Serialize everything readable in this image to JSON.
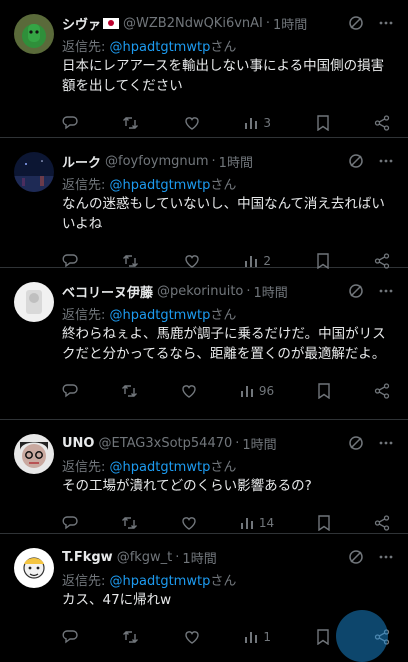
{
  "reply_prefix": "返信先:",
  "san_suffix": "さん",
  "tweets": [
    {
      "name": "シヴァ",
      "handle": "@WZB2NdwQKi6vnAI",
      "separator": "·",
      "time": "1時間",
      "reply_to": "@hpadtgtmwtp",
      "text": "日本にレアアースを輸出しない事による中国側の損害額を出してください",
      "views": "3"
    },
    {
      "name": "ルーク",
      "handle": "@foyfoymgnum",
      "separator": "·",
      "time": "1時間",
      "reply_to": "@hpadtgtmwtp",
      "text": "なんの迷惑もしていないし、中国なんて消え去ればいいよね",
      "views": "2"
    },
    {
      "name": "ベコリーヌ伊藤",
      "handle": "@pekorinuito",
      "separator": "·",
      "time": "1時間",
      "reply_to": "@hpadtgtmwtp",
      "text": "終わらねぇよ、馬鹿が調子に乗るだけだ。中国がリスクだと分かってるなら、距離を置くのが最適解だよ。",
      "views": "96"
    },
    {
      "name": "UNO",
      "handle": "@ETAG3xSotp54470",
      "separator": "·",
      "time": "1時間",
      "reply_to": "@hpadtgtmwtp",
      "text": "その工場が潰れてどのくらい影響あるの?",
      "views": "14"
    },
    {
      "name": "T.Fkgw",
      "handle": "@fkgw_t",
      "separator": "·",
      "time": "1時間",
      "reply_to": "@hpadtgtmwtp",
      "text": "カス、47に帰れw",
      "views": "1"
    }
  ],
  "colors": {
    "background": "#000000",
    "text": "#e7e9ea",
    "muted": "#71767b",
    "link": "#1d9bf0",
    "divider": "#2f3336"
  },
  "icons": [
    "grok-icon",
    "more-icon",
    "reply-icon",
    "retweet-icon",
    "like-icon",
    "views-icon",
    "bookmark-icon",
    "share-icon"
  ]
}
